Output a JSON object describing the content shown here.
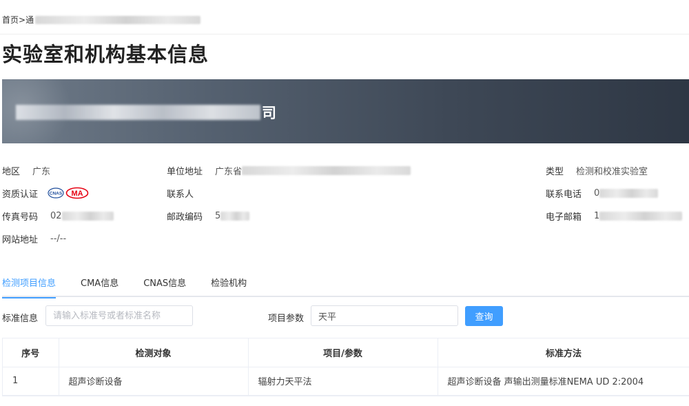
{
  "breadcrumb": {
    "home": "首页",
    "separator": ">",
    "current_visible": "通"
  },
  "page_title": "实验室和机构基本信息",
  "banner": {
    "name_visible_suffix": "司"
  },
  "info": {
    "region": {
      "label": "地区",
      "value": "广东"
    },
    "address": {
      "label": "单位地址",
      "value_prefix": "广东省"
    },
    "type": {
      "label": "类型",
      "value": "检测和校准实验室"
    },
    "qualification": {
      "label": "资质认证",
      "icons": [
        "cnas-logo-icon",
        "cma-logo-icon"
      ],
      "cnas_text": "CNAS",
      "ma_text": "MA"
    },
    "contact": {
      "label": "联系人",
      "value": ""
    },
    "phone": {
      "label": "联系电话",
      "value_prefix": "0"
    },
    "fax": {
      "label": "传真号码",
      "value_prefix": "02"
    },
    "postcode": {
      "label": "邮政编码",
      "value_prefix": "5"
    },
    "email": {
      "label": "电子邮箱",
      "value_prefix": "1"
    },
    "website": {
      "label": "网站地址",
      "value": "--/--"
    }
  },
  "tabs": [
    {
      "label": "检测项目信息",
      "active": true
    },
    {
      "label": "CMA信息",
      "active": false
    },
    {
      "label": "CNAS信息",
      "active": false
    },
    {
      "label": "检验机构",
      "active": false
    }
  ],
  "filters": {
    "standard": {
      "label": "标准信息",
      "placeholder": "请输入标准号或者标准名称",
      "value": ""
    },
    "param": {
      "label": "项目参数",
      "value": "天平"
    },
    "query_label": "查询"
  },
  "table": {
    "headers": [
      "序号",
      "检测对象",
      "项目/参数",
      "标准方法"
    ],
    "rows": [
      [
        "1",
        "超声诊断设备",
        "辐射力天平法",
        "超声诊断设备 声输出测量标准NEMA UD 2:2004"
      ]
    ]
  },
  "colors": {
    "accent": "#409eff",
    "banner_dark": "#2e3744",
    "cma_red": "#e60012",
    "cnas_blue": "#1f4e9c"
  }
}
